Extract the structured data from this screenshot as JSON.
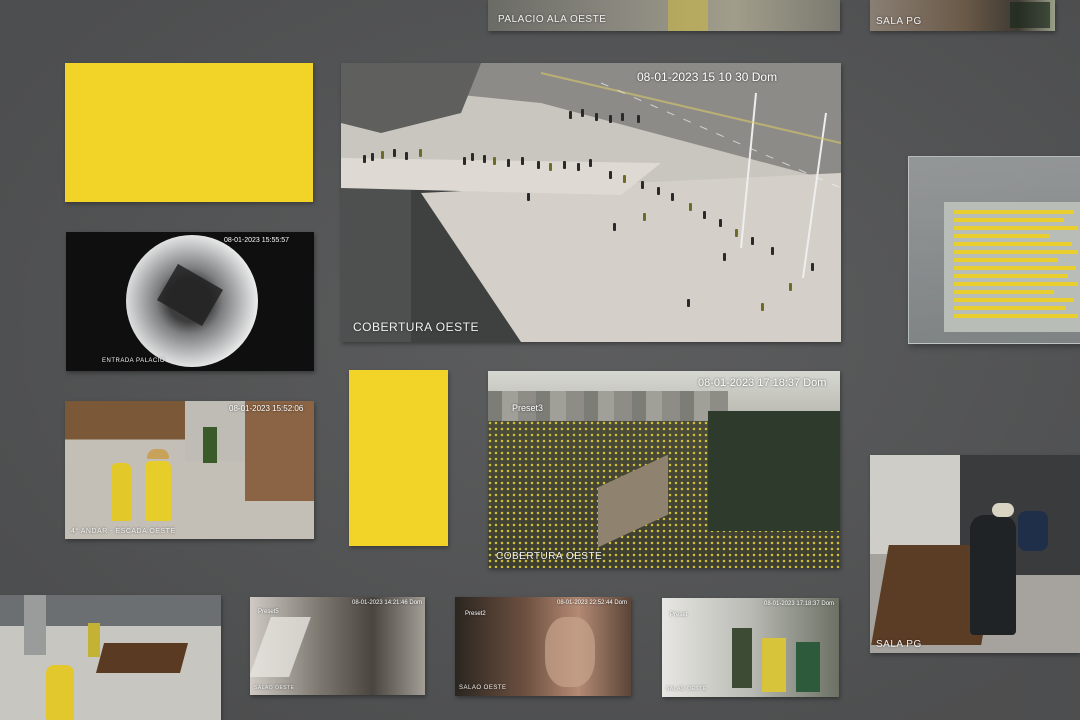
{
  "wall": {
    "background": "#545556",
    "accent_yellow": "#f2d327"
  },
  "photos": {
    "palacio_ala_oeste": {
      "caption": "PALACIO ALA OESTE"
    },
    "sala_pg_top": {
      "caption": "SALA PG"
    },
    "cobertura_oeste_main": {
      "timestamp": "08-01-2023 15 10 30 Dom",
      "caption": "COBERTURA OESTE"
    },
    "entrada_palacio": {
      "timestamp": "08-01-2023 15:55:57",
      "caption": "ENTRADA PALACIO"
    },
    "quarto_andar": {
      "timestamp": "08-01-2023 15:52:06",
      "caption": "4° ANDAR - ESCADA OESTE"
    },
    "cobertura_oeste_crowd": {
      "timestamp": "08-01-2023 17:18:37 Dom",
      "preset": "Preset3",
      "caption": "COBERTURA OESTE"
    },
    "sala_pg_right": {
      "caption": "SALA PG"
    },
    "bottom_1": {
      "timestamp": "08-01-2023 14:21:46 Dom",
      "preset": "Preset5",
      "caption": "SALAO OESTE"
    },
    "bottom_2": {
      "timestamp": "08-01-2023 22:52:44 Dom",
      "preset": "Preset2",
      "caption": "SALAO OESTE"
    },
    "bottom_3": {
      "timestamp": "08-01-2023 17:18:37 Dom",
      "preset": "Preset",
      "caption": "SALAO OESTE"
    }
  }
}
